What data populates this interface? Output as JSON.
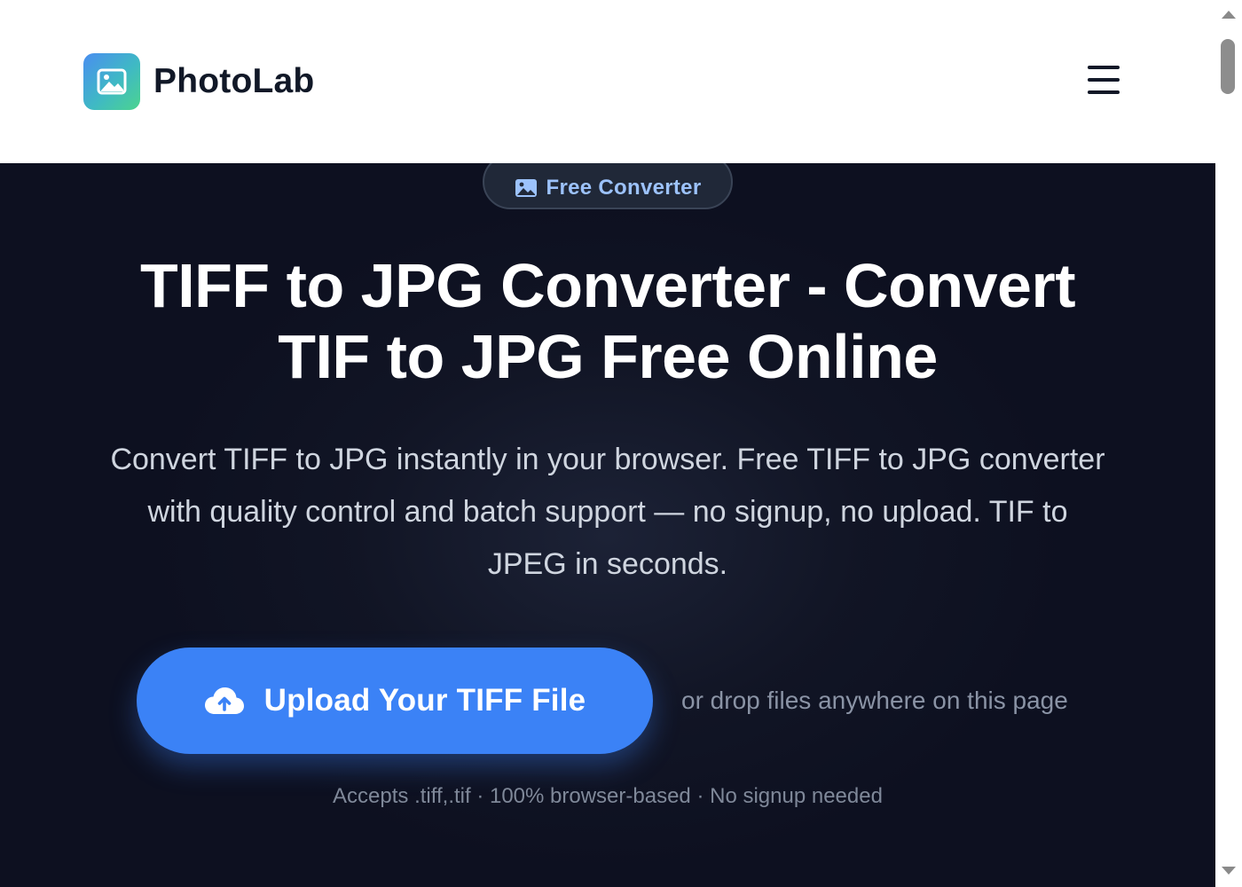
{
  "header": {
    "brand_name": "PhotoLab",
    "logo_icon": "image-icon",
    "menu_icon": "hamburger-menu-icon"
  },
  "hero": {
    "badge_label": "Free Converter",
    "badge_icon": "image-icon",
    "title_line1": "TIFF to JPG Converter - Convert",
    "title_line2": "TIF to JPG Free Online",
    "subtitle_line1": "Convert TIFF to JPG instantly in your browser. Free TIFF to JPG converter",
    "subtitle_line2": "with quality control and batch support — no signup, no upload. TIF to",
    "subtitle_line3": "JPEG in seconds.",
    "upload_label": "Upload Your TIFF File",
    "upload_icon": "cloud-upload-icon",
    "drop_hint": "or drop files anywhere on this page",
    "accepts_note": "Accepts .tiff,.tif · 100% browser-based · No signup needed"
  },
  "colors": {
    "accent": "#3b82f6",
    "hero_background": "#0d1020",
    "badge_text": "#9cc2fb"
  }
}
